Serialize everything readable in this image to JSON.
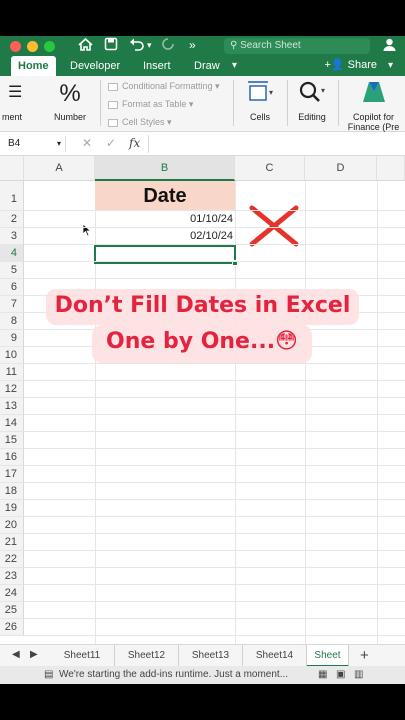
{
  "titlebar": {
    "search_placeholder": "Search Sheet"
  },
  "tabs": [
    "Home",
    "Developer",
    "Insert",
    "Draw"
  ],
  "share_label": "Share",
  "ribbon": {
    "alignment_label": "ment",
    "number_label": "Number",
    "number_glyph": "%",
    "conditional_formatting": "Conditional Formatting",
    "format_as_table": "Format as Table",
    "cell_styles": "Cell Styles",
    "cells_label": "Cells",
    "editing_label": "Editing",
    "copilot_line1": "Copilot for",
    "copilot_line2": "Finance (Pre"
  },
  "formula_bar": {
    "name_box": "B4",
    "fx_glyph": "fx"
  },
  "columns": [
    "A",
    "B",
    "C",
    "D"
  ],
  "rows": [
    "1",
    "2",
    "3",
    "4",
    "5",
    "6",
    "7",
    "8",
    "9",
    "10",
    "11",
    "12",
    "13",
    "14",
    "15",
    "16",
    "17",
    "18",
    "19",
    "20",
    "21",
    "22",
    "23",
    "24",
    "25",
    "26"
  ],
  "cells": {
    "B1": "Date",
    "B2": "01/10/24",
    "B3": "02/10/24"
  },
  "overlay": {
    "line1": "Don’t Fill Dates in Excel",
    "line2": "One by One...😳"
  },
  "sheet_tabs": [
    "Sheet11",
    "Sheet12",
    "Sheet13",
    "Sheet14",
    "Sheet"
  ],
  "status_text": "We're starting the add-ins runtime. Just a moment...",
  "colors": {
    "accent": "#1f7a47",
    "header_fill": "#f9d7c8",
    "cross": "#e5332a",
    "overlay_text": "#e4233e"
  }
}
